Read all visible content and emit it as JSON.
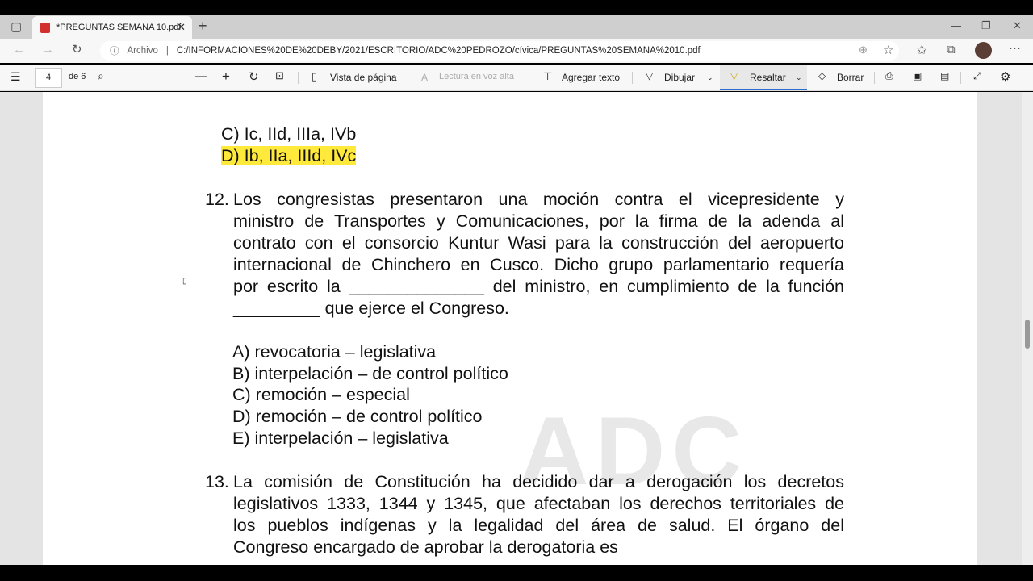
{
  "tab": {
    "title": "*PREGUNTAS SEMANA 10.pdf"
  },
  "address": {
    "label": "Archivo",
    "url": "C:/INFORMACIONES%20DE%20DEBY/2021/ESCRITORIO/ADC%20PEDROZO/cívica/PREGUNTAS%20SEMANA%2010.pdf"
  },
  "toolbar": {
    "page": "4",
    "of": "de 6",
    "page_view": "Vista de página",
    "read_aloud": "Lectura en voz alta",
    "add_text": "Agregar texto",
    "draw": "Dibujar",
    "highlight": "Resaltar",
    "erase": "Borrar"
  },
  "doc": {
    "prev_c": "C) Ic, IId, IIIa, IVb",
    "prev_d": "D) Ib, IIa, IIId, IVc",
    "q12_num": "12.",
    "q12_lines": [
      "Los congresistas presentaron una moción contra el vicepresidente y",
      "ministro de Transportes y Comunicaciones, por la firma de la adenda al",
      "contrato con el consorcio Kuntur Wasi para la construcción del aeropuerto",
      "internacional de Chinchero en Cusco. Dicho grupo parlamentario requería",
      "por escrito la ______________ del ministro, en cumplimiento de la función",
      "_________ que ejerce el Congreso."
    ],
    "q12_options": [
      "A) revocatoria – legislativa",
      "B) interpelación – de control político",
      "C) remoción – especial",
      "D) remoción – de control político",
      "E) interpelación – legislativa"
    ],
    "q13_num": "13.",
    "q13_lines": [
      "La comisión de Constitución ha decidido dar a derogación los decretos",
      "legislativos 1333, 1344 y 1345, que afectaban los derechos territoriales de",
      "los pueblos indígenas y la legalidad del área de salud. El órgano del",
      "Congreso encargado de aprobar la derogatoria es"
    ],
    "watermark": "ADC"
  }
}
